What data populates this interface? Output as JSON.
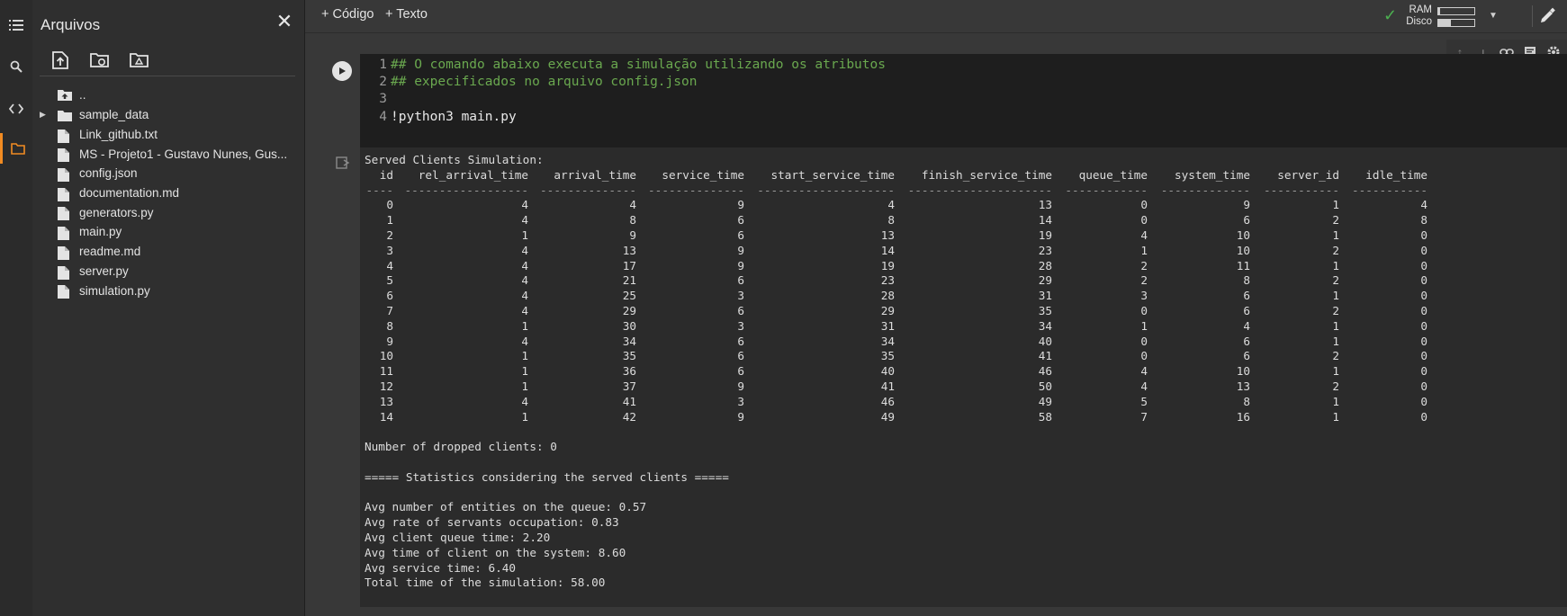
{
  "sidebar_rail": {
    "items": [
      {
        "name": "toc-icon",
        "glyph": "☰"
      },
      {
        "name": "search-icon",
        "glyph": "⌕"
      },
      {
        "name": "code-snippets-icon",
        "glyph": "<>"
      },
      {
        "name": "files-folder-icon",
        "glyph": "▭"
      }
    ],
    "active_color": "#f18b22"
  },
  "files_panel": {
    "title": "Arquivos",
    "tools": [
      "upload-file-icon",
      "refresh-folder-icon",
      "mount-drive-icon"
    ],
    "items": [
      {
        "label": "..",
        "type": "parent"
      },
      {
        "label": "sample_data",
        "type": "folder"
      },
      {
        "label": "Link_github.txt",
        "type": "file"
      },
      {
        "label": "MS - Projeto1 - Gustavo Nunes, Gus...",
        "type": "file"
      },
      {
        "label": "config.json",
        "type": "file"
      },
      {
        "label": "documentation.md",
        "type": "file"
      },
      {
        "label": "generators.py",
        "type": "file"
      },
      {
        "label": "main.py",
        "type": "file"
      },
      {
        "label": "readme.md",
        "type": "file"
      },
      {
        "label": "server.py",
        "type": "file"
      },
      {
        "label": "simulation.py",
        "type": "file"
      }
    ]
  },
  "toolbar": {
    "add_code": "+ Código",
    "add_text": "+ Texto",
    "ram_label": "RAM",
    "disk_label": "Disco",
    "ram_fraction": 0.05,
    "disk_fraction": 0.35
  },
  "cell": {
    "code_lines": [
      {
        "n": "1",
        "text": "## O comando abaixo executa a simulação utilizando os atributos",
        "kind": "comment"
      },
      {
        "n": "2",
        "text": "## expecificados no arquivo config.json",
        "kind": "comment"
      },
      {
        "n": "3",
        "text": "",
        "kind": "plain"
      },
      {
        "n": "4",
        "text": "!python3 main.py",
        "kind": "plain"
      }
    ]
  },
  "output": {
    "heading": "Served Clients Simulation:",
    "columns": [
      "id",
      "rel_arrival_time",
      "arrival_time",
      "service_time",
      "start_service_time",
      "finish_service_time",
      "queue_time",
      "system_time",
      "server_id",
      "idle_time"
    ],
    "separators": [
      "----",
      "------------------",
      "--------------",
      "--------------",
      "--------------------",
      "---------------------",
      "------------",
      "-------------",
      "-----------",
      "-----------"
    ],
    "rows": [
      [
        "0",
        "4",
        "4",
        "9",
        "4",
        "13",
        "0",
        "9",
        "1",
        "4"
      ],
      [
        "1",
        "4",
        "8",
        "6",
        "8",
        "14",
        "0",
        "6",
        "2",
        "8"
      ],
      [
        "2",
        "1",
        "9",
        "6",
        "13",
        "19",
        "4",
        "10",
        "1",
        "0"
      ],
      [
        "3",
        "4",
        "13",
        "9",
        "14",
        "23",
        "1",
        "10",
        "2",
        "0"
      ],
      [
        "4",
        "4",
        "17",
        "9",
        "19",
        "28",
        "2",
        "11",
        "1",
        "0"
      ],
      [
        "5",
        "4",
        "21",
        "6",
        "23",
        "29",
        "2",
        "8",
        "2",
        "0"
      ],
      [
        "6",
        "4",
        "25",
        "3",
        "28",
        "31",
        "3",
        "6",
        "1",
        "0"
      ],
      [
        "7",
        "4",
        "29",
        "6",
        "29",
        "35",
        "0",
        "6",
        "2",
        "0"
      ],
      [
        "8",
        "1",
        "30",
        "3",
        "31",
        "34",
        "1",
        "4",
        "1",
        "0"
      ],
      [
        "9",
        "4",
        "34",
        "6",
        "34",
        "40",
        "0",
        "6",
        "1",
        "0"
      ],
      [
        "10",
        "1",
        "35",
        "6",
        "35",
        "41",
        "0",
        "6",
        "2",
        "0"
      ],
      [
        "11",
        "1",
        "36",
        "6",
        "40",
        "46",
        "4",
        "10",
        "1",
        "0"
      ],
      [
        "12",
        "1",
        "37",
        "9",
        "41",
        "50",
        "4",
        "13",
        "2",
        "0"
      ],
      [
        "13",
        "4",
        "41",
        "3",
        "46",
        "49",
        "5",
        "8",
        "1",
        "0"
      ],
      [
        "14",
        "1",
        "42",
        "9",
        "49",
        "58",
        "7",
        "16",
        "1",
        "0"
      ]
    ],
    "dropped": "Number of dropped clients: 0",
    "stats_header": "===== Statistics considering the served clients =====",
    "stats": [
      "Avg number of entities on the queue: 0.57",
      "Avg rate of servants occupation: 0.83",
      "Avg client queue time: 2.20",
      "Avg time of client on the system: 8.60",
      "Avg service time: 6.40",
      "Total time of the simulation: 58.00"
    ]
  }
}
